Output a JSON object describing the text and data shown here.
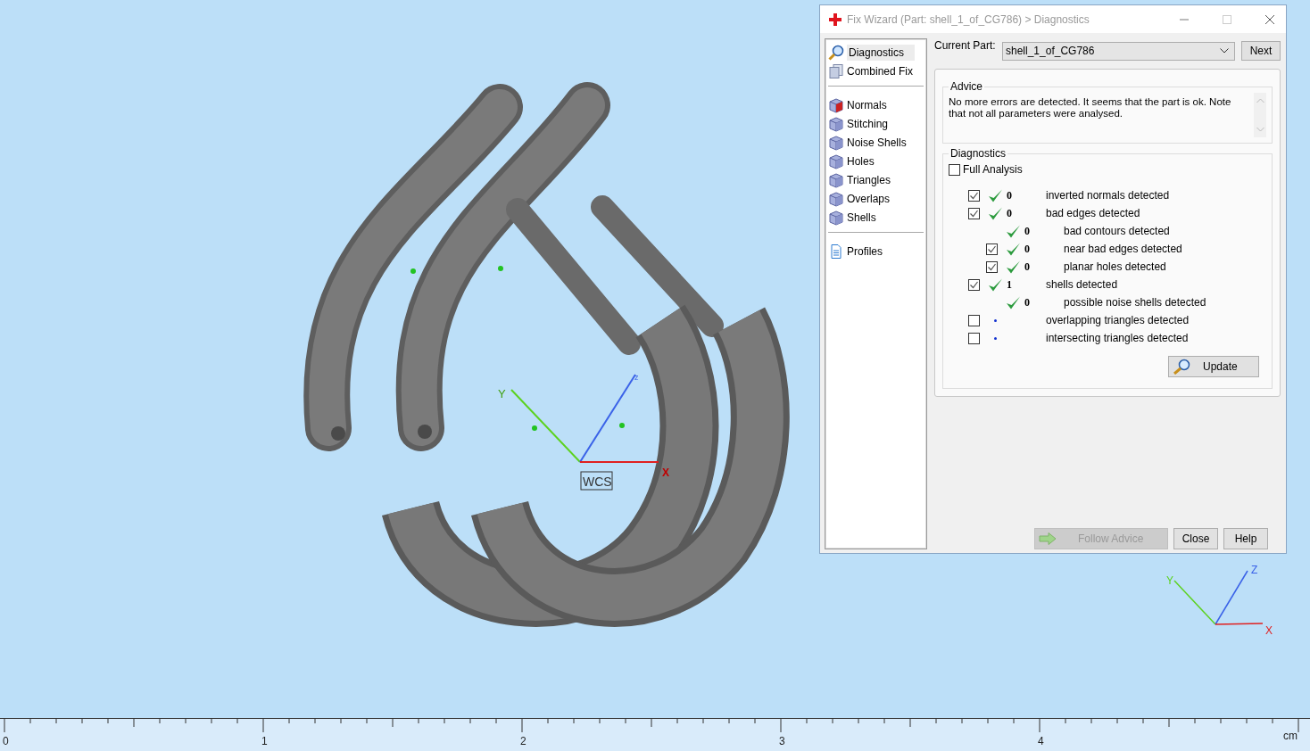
{
  "viewport": {
    "wcs_label": "WCS",
    "center_axes": {
      "x": "X",
      "y": "Y",
      "z": "z"
    },
    "corner_axes": {
      "x": "X",
      "y": "Y",
      "z": "Z"
    }
  },
  "window": {
    "title": "Fix Wizard (Part: shell_1_of_CG786) > Diagnostics"
  },
  "sidebar": {
    "groups": [
      {
        "items": [
          {
            "label": "Diagnostics",
            "selected": true
          },
          {
            "label": "Combined Fix",
            "selected": false
          }
        ]
      },
      {
        "items": [
          {
            "label": "Normals",
            "selected": false
          },
          {
            "label": "Stitching",
            "selected": false
          },
          {
            "label": "Noise Shells",
            "selected": false
          },
          {
            "label": "Holes",
            "selected": false
          },
          {
            "label": "Triangles",
            "selected": false
          },
          {
            "label": "Overlaps",
            "selected": false
          },
          {
            "label": "Shells",
            "selected": false
          }
        ]
      },
      {
        "items": [
          {
            "label": "Profiles",
            "selected": false
          }
        ]
      }
    ]
  },
  "current_part": {
    "label": "Current Part:",
    "value": "shell_1_of_CG786"
  },
  "next_button": "Next",
  "advice": {
    "title": "Advice",
    "text": "No more errors are detected. It seems that the part is ok. Note that not all parameters were analysed."
  },
  "diagnostics": {
    "title": "Diagnostics",
    "full_analysis": {
      "label": "Full Analysis",
      "checked": false
    },
    "rows": [
      {
        "kind": "checkbox",
        "checked": true,
        "analysed": true,
        "count": "0",
        "label": "inverted normals detected"
      },
      {
        "kind": "checkbox",
        "checked": true,
        "analysed": true,
        "count": "0",
        "label": "bad edges detected",
        "children": [
          {
            "kind": "plain",
            "analysed": true,
            "count": "0",
            "label": "bad contours detected"
          },
          {
            "kind": "checkbox",
            "checked": true,
            "analysed": true,
            "count": "0",
            "label": "near bad edges detected"
          },
          {
            "kind": "checkbox",
            "checked": true,
            "analysed": true,
            "count": "0",
            "label": "planar holes detected"
          }
        ]
      },
      {
        "kind": "checkbox",
        "checked": true,
        "analysed": true,
        "count": "1",
        "label": "shells detected",
        "children": [
          {
            "kind": "plain",
            "analysed": true,
            "count": "0",
            "label": "possible noise shells detected"
          }
        ]
      },
      {
        "kind": "checkbox",
        "checked": false,
        "analysed": false,
        "label": "overlapping triangles detected"
      },
      {
        "kind": "checkbox",
        "checked": false,
        "analysed": false,
        "label": "intersecting triangles detected"
      }
    ],
    "update_button": "Update"
  },
  "buttons": [
    {
      "label": "Follow Advice",
      "disabled": true
    },
    {
      "label": "Close",
      "disabled": false
    },
    {
      "label": "Help",
      "disabled": false
    }
  ],
  "ruler": {
    "labels": [
      "0",
      "1",
      "2",
      "3",
      "4"
    ],
    "unit": "cm"
  }
}
